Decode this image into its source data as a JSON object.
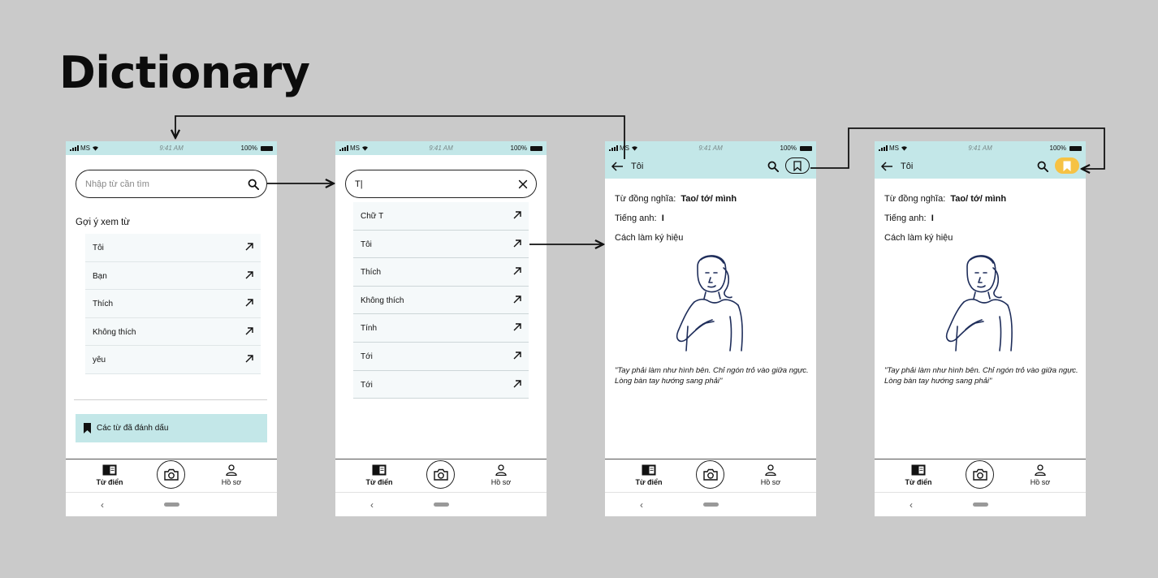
{
  "page_title": "Dictionary",
  "status": {
    "carrier": "MS",
    "time": "9:41 AM",
    "battery": "100%"
  },
  "screen1": {
    "search_placeholder": "Nhập từ cần tìm",
    "suggest_label": "Gợi ý xem từ",
    "suggestions": [
      {
        "label": "Tôi"
      },
      {
        "label": "Bạn"
      },
      {
        "label": "Thích"
      },
      {
        "label": "Không thích"
      },
      {
        "label": "yêu"
      }
    ],
    "bookmarks_label": "Các từ đã đánh dấu"
  },
  "screen2": {
    "search_value": "T|",
    "results": [
      {
        "label": "Chữ T"
      },
      {
        "label": "Tôi"
      },
      {
        "label": "Thích"
      },
      {
        "label": "Không thích"
      },
      {
        "label": "Tính"
      },
      {
        "label": "Tới"
      },
      {
        "label": "Tới"
      }
    ]
  },
  "detail": {
    "title": "Tôi",
    "synonym_label": "Từ đồng nghĩa:",
    "synonym_value": "Tao/ tớ/ mình",
    "english_label": "Tiếng anh:",
    "english_value": "I",
    "howto_label": "Cách làm ký hiệu",
    "caption": "\"Tay phải làm như hình bên. Chỉ ngón trỏ vào giữa ngực. Lòng bàn tay hướng sang phải\""
  },
  "nav": {
    "dictionary": "Từ điển",
    "profile": "Hồ sơ"
  },
  "colors": {
    "header": "#c3e7e8",
    "bookmark_active": "#f6c244",
    "background": "#cacaca"
  }
}
